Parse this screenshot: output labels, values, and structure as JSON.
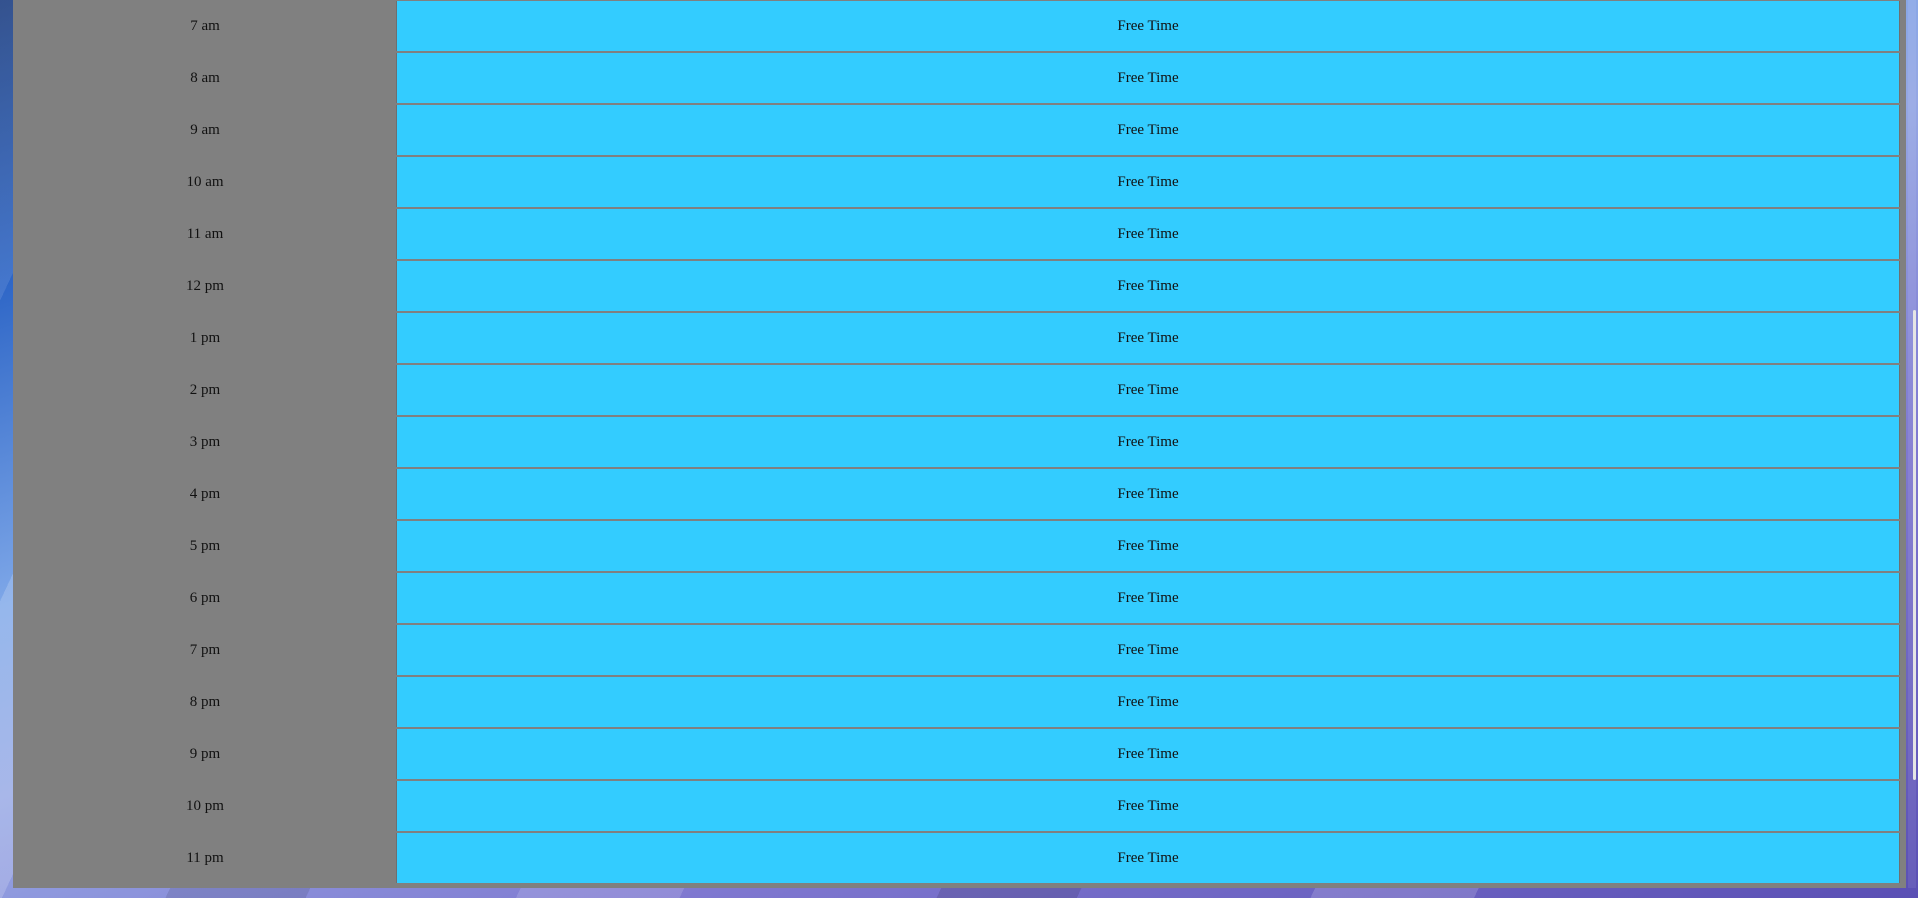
{
  "slots": [
    {
      "time": "7 am",
      "label": "Free Time"
    },
    {
      "time": "8 am",
      "label": "Free Time"
    },
    {
      "time": "9 am",
      "label": "Free Time"
    },
    {
      "time": "10 am",
      "label": "Free Time"
    },
    {
      "time": "11 am",
      "label": "Free Time"
    },
    {
      "time": "12 pm",
      "label": "Free Time"
    },
    {
      "time": "1 pm",
      "label": "Free Time"
    },
    {
      "time": "2 pm",
      "label": "Free Time"
    },
    {
      "time": "3 pm",
      "label": "Free Time"
    },
    {
      "time": "4 pm",
      "label": "Free Time"
    },
    {
      "time": "5 pm",
      "label": "Free Time"
    },
    {
      "time": "6 pm",
      "label": "Free Time"
    },
    {
      "time": "7 pm",
      "label": "Free Time"
    },
    {
      "time": "8 pm",
      "label": "Free Time"
    },
    {
      "time": "9 pm",
      "label": "Free Time"
    },
    {
      "time": "10 pm",
      "label": "Free Time"
    },
    {
      "time": "11 pm",
      "label": "Free Time"
    }
  ],
  "colors": {
    "slot_background": "#33ccff",
    "time_column_background": "#808080"
  }
}
